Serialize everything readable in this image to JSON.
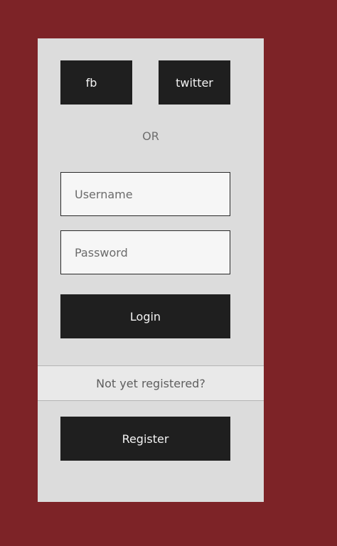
{
  "social": {
    "fb_label": "fb",
    "twitter_label": "twitter"
  },
  "separator_text": "OR",
  "form": {
    "username_placeholder": "Username",
    "password_placeholder": "Password",
    "login_label": "Login"
  },
  "register_section": {
    "prompt": "Not yet registered?",
    "register_label": "Register"
  },
  "colors": {
    "background": "#7d2327",
    "panel": "#dcdcdc",
    "button": "#1f1f1f"
  }
}
